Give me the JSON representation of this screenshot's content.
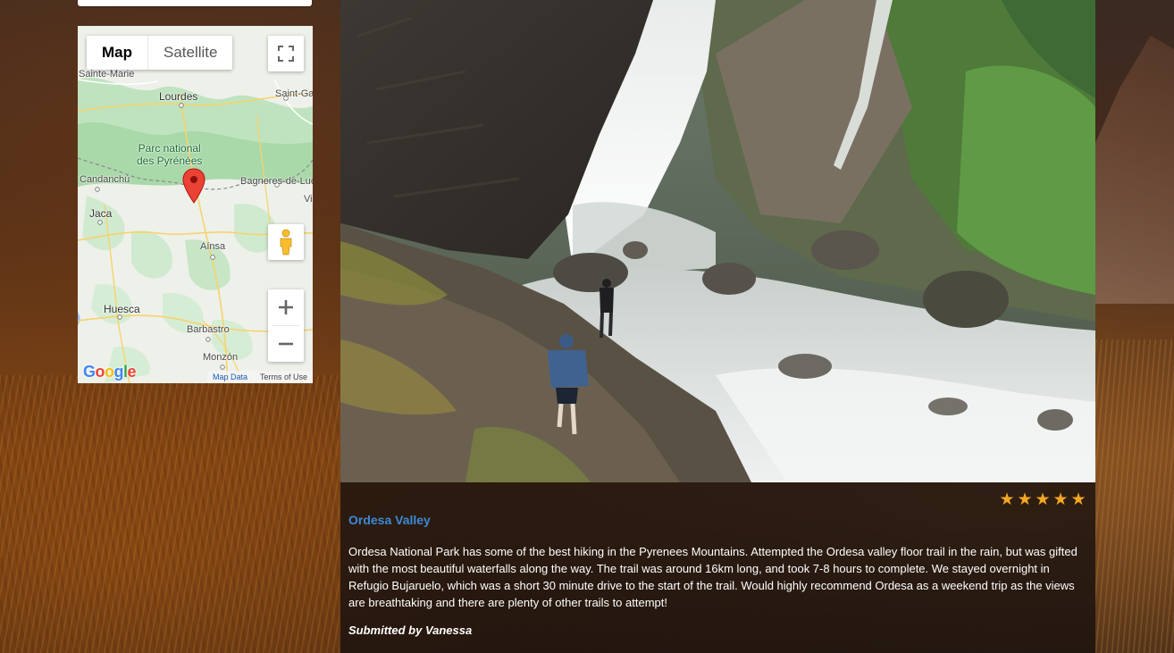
{
  "map": {
    "type_buttons": {
      "map": "Map",
      "satellite": "Satellite"
    },
    "labels": {
      "sainte_marie": "Sainte-Marie",
      "lourdes": "Lourdes",
      "saint_ga": "Saint-Ga",
      "park": "Parc national",
      "park2": "des Pyrénées",
      "candanchu": "Candanchú",
      "bagneres": "Bagneres-de-Luc",
      "vi": "Vi",
      "jaca": "Jaca",
      "ainsa": "Aínsa",
      "huesca": "Huesca",
      "barbastro": "Barbastro",
      "monzon": "Monzón"
    },
    "footer": {
      "logo": "Google",
      "map_data": "Map Data",
      "terms": "Terms of Use"
    },
    "icons": [
      "fullscreen-icon",
      "pegman-icon",
      "zoom-in-icon",
      "zoom-out-icon",
      "map-marker-icon"
    ]
  },
  "post": {
    "rating": 5,
    "stars": [
      "★",
      "★",
      "★",
      "★",
      "★"
    ],
    "title": "Ordesa Valley",
    "description": "Ordesa National Park has some of the best hiking in the Pyrenees Mountains. Attempted the Ordesa valley floor trail in the rain, but was gifted with the most beautiful waterfalls along the way. The trail was around 16km long, and took 7-8 hours to complete. We stayed overnight in Refugio Bujaruelo, which was a short 30 minute drive to the start of the trail. Would highly recommend Ordesa as a weekend trip as the views are breathtaking and there are plenty of other trails to attempt!",
    "submitted_by": "Submitted by Vanessa"
  },
  "colors": {
    "title_link": "#3a8ad8",
    "star": "#f5a623",
    "map_marker": "#ea4335",
    "park_green": "#1c6b33"
  }
}
